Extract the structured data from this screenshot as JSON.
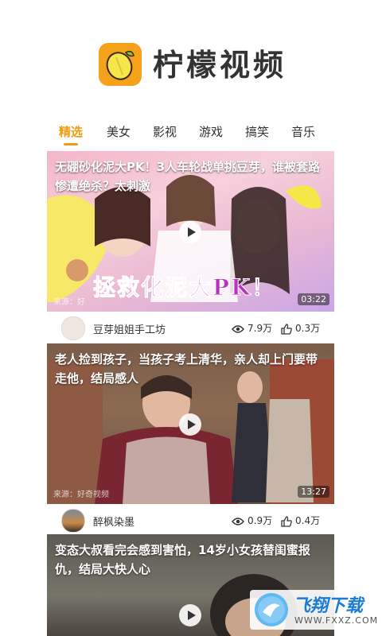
{
  "app": {
    "title": "柠檬视频"
  },
  "tabs": [
    {
      "label": "精选",
      "active": true
    },
    {
      "label": "美女",
      "active": false
    },
    {
      "label": "影视",
      "active": false
    },
    {
      "label": "游戏",
      "active": false
    },
    {
      "label": "搞笑",
      "active": false
    },
    {
      "label": "音乐",
      "active": false
    }
  ],
  "videos": [
    {
      "title": "无硼砂化泥大PK！3人车轮战单挑豆芽，谁被套路惨遭绝杀？太刺激",
      "overlay_text": "拯救化泥大PK！",
      "duration": "03:22",
      "source": "来源：好",
      "author": "豆芽姐姐手工坊",
      "views": "7.9万",
      "likes": "0.3万"
    },
    {
      "title": "老人捡到孩子，当孩子考上清华，亲人却上门要带走他，结局感人",
      "duration": "13:27",
      "source": "来源：好奇视频",
      "author": "醉枫染墨",
      "views": "0.9万",
      "likes": "0.4万"
    },
    {
      "title": "变态大叔看完会感到害怕，14岁小女孩替闺蜜报仇，结局大快人心"
    }
  ],
  "watermark": {
    "name": "飞翔下载",
    "url": "WWW.FXXZ.COM"
  },
  "colors": {
    "accent": "#f29a12",
    "logo": "#f6a11a"
  },
  "icons": {
    "views": "eye-icon",
    "likes": "thumbs-up-icon",
    "play": "play-icon"
  }
}
